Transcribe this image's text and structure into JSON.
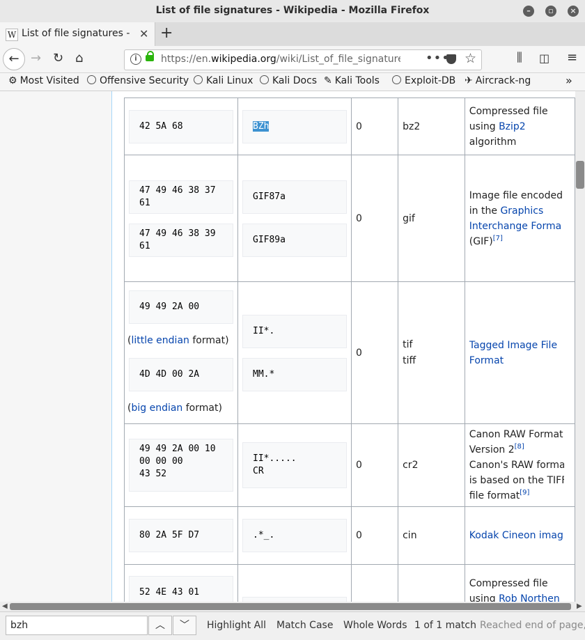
{
  "window": {
    "title": "List of file signatures - Wikipedia - Mozilla Firefox"
  },
  "tab": {
    "favicon": "W",
    "label": "List of file signatures - Wikipedia",
    "close": "✕",
    "new_tab": "+"
  },
  "nav": {
    "url_prefix": "https://en.",
    "url_domain": "wikipedia.org",
    "url_path": "/wiki/List_of_file_signatures",
    "page_actions": "•••"
  },
  "bookmarks": [
    "Most Visited",
    "Offensive Security",
    "Kali Linux",
    "Kali Docs",
    "Kali Tools",
    "Exploit-DB",
    "Aircrack-ng"
  ],
  "table": {
    "rows": [
      {
        "hex": [
          "42 5A 68"
        ],
        "iso": [
          "BZh"
        ],
        "offset": "0",
        "ext": [
          "bz2"
        ],
        "desc": {
          "pre": "Compressed file",
          "line2_pre": "using ",
          "link": "Bzip2",
          "post": "algorithm"
        }
      },
      {
        "hex": [
          "47 49 46 38 37\n61",
          "47 49 46 38 39\n61"
        ],
        "iso": [
          "GIF87a",
          "GIF89a"
        ],
        "offset": "0",
        "ext": [
          "gif"
        ],
        "desc": {
          "pre": "Image file encoded",
          "line2_pre": "in the ",
          "link": "Graphics",
          "link2": "Interchange Forma",
          "post": "(GIF)",
          "ref": "[7]"
        }
      },
      {
        "hex": [
          "49 49 2A 00",
          "4D 4D 00 2A"
        ],
        "hex_notes": [
          {
            "pre": "(",
            "link": "little endian",
            "post": " format)"
          },
          {
            "pre": "(",
            "link": "big endian",
            "post": " format)"
          }
        ],
        "iso": [
          "II*.",
          "MM.*"
        ],
        "offset": "0",
        "ext": [
          "tif",
          "tiff"
        ],
        "desc": {
          "link": "Tagged Image File",
          "link2": "Format"
        }
      },
      {
        "hex": [
          "49 49 2A 00 10\n00 00 00\n43 52"
        ],
        "iso": [
          "II*.....\nCR"
        ],
        "offset": "0",
        "ext": [
          "cr2"
        ],
        "desc": {
          "l1": "Canon RAW Format",
          "l2": "Version 2",
          "ref1": "[8]",
          "l3": "Canon's RAW forma",
          "l4": "is based on the TIFF",
          "l5": "file format",
          "ref2": "[9]"
        }
      },
      {
        "hex": [
          "80 2A 5F D7"
        ],
        "iso": [
          ".*_."
        ],
        "offset": "0",
        "ext": [
          "cin"
        ],
        "desc": {
          "link": "Kodak Cineon imag"
        }
      },
      {
        "hex": [
          "52 4E 43 01"
        ],
        "iso": [
          ""
        ],
        "offset": "",
        "ext": [
          ""
        ],
        "desc": {
          "pre": "Compressed file",
          "line2_pre": "using ",
          "link": "Rob Northen"
        }
      }
    ]
  },
  "findbar": {
    "query": "bzh",
    "highlight_all": "Highlight All",
    "match_case": "Match Case",
    "whole_words": "Whole Words",
    "status": "1 of 1 match",
    "end_notice": "Reached end of page, continued from top"
  }
}
